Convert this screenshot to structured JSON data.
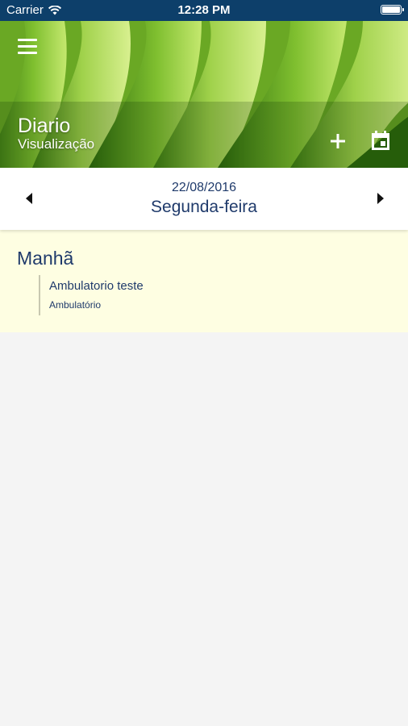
{
  "status_bar": {
    "carrier": "Carrier",
    "time": "12:28 PM"
  },
  "header": {
    "title": "Diario",
    "subtitle": "Visualização",
    "menu_icon": "hamburger-menu-icon",
    "add_icon": "plus-icon",
    "calendar_icon": "calendar-icon"
  },
  "date_nav": {
    "date": "22/08/2016",
    "weekday": "Segunda-feira",
    "prev_icon": "arrow-left-icon",
    "next_icon": "arrow-right-icon"
  },
  "periods": [
    {
      "title": "Manhã",
      "entries": [
        {
          "title": "Ambulatorio teste",
          "subtitle": "Ambulatório"
        }
      ]
    }
  ],
  "colors": {
    "status_bar": "#0d3f6a",
    "text_primary": "#1f3a6b",
    "period_background": "#fefee2",
    "page_background": "#f4f4f4"
  }
}
